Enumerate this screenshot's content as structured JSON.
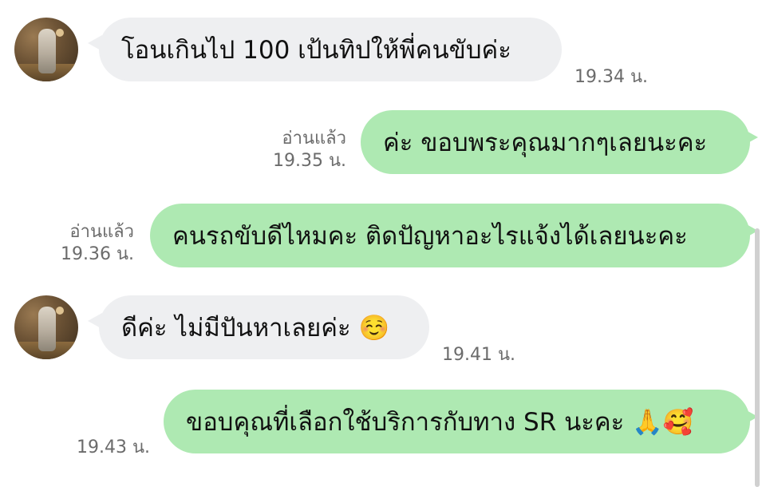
{
  "messages": [
    {
      "side": "in",
      "text": "โอนเกินไป 100 เป้นทิปให้พี่คนขับค่ะ",
      "time": "19.34 น."
    },
    {
      "side": "out",
      "text": "ค่ะ ขอบพระคุณมากๆเลยนะคะ",
      "read": "อ่านแล้ว",
      "time": "19.35 น."
    },
    {
      "side": "out",
      "text": "คนรถขับดีไหมคะ ติดปัญหาอะไรแจ้งได้เลยนะคะ",
      "read": "อ่านแล้ว",
      "time": "19.36 น."
    },
    {
      "side": "in",
      "text": "ดีค่ะ ไม่มีปันหาเลยค่ะ ☺️",
      "time": "19.41 น."
    },
    {
      "side": "out",
      "text": "ขอบคุณที่เลือกใช้บริการกับทาง SR นะคะ 🙏🥰",
      "time": "19.43 น."
    }
  ],
  "colors": {
    "incoming_bubble": "#eeeff1",
    "outgoing_bubble": "#aee9b2",
    "meta_text": "#6b6b6b"
  }
}
